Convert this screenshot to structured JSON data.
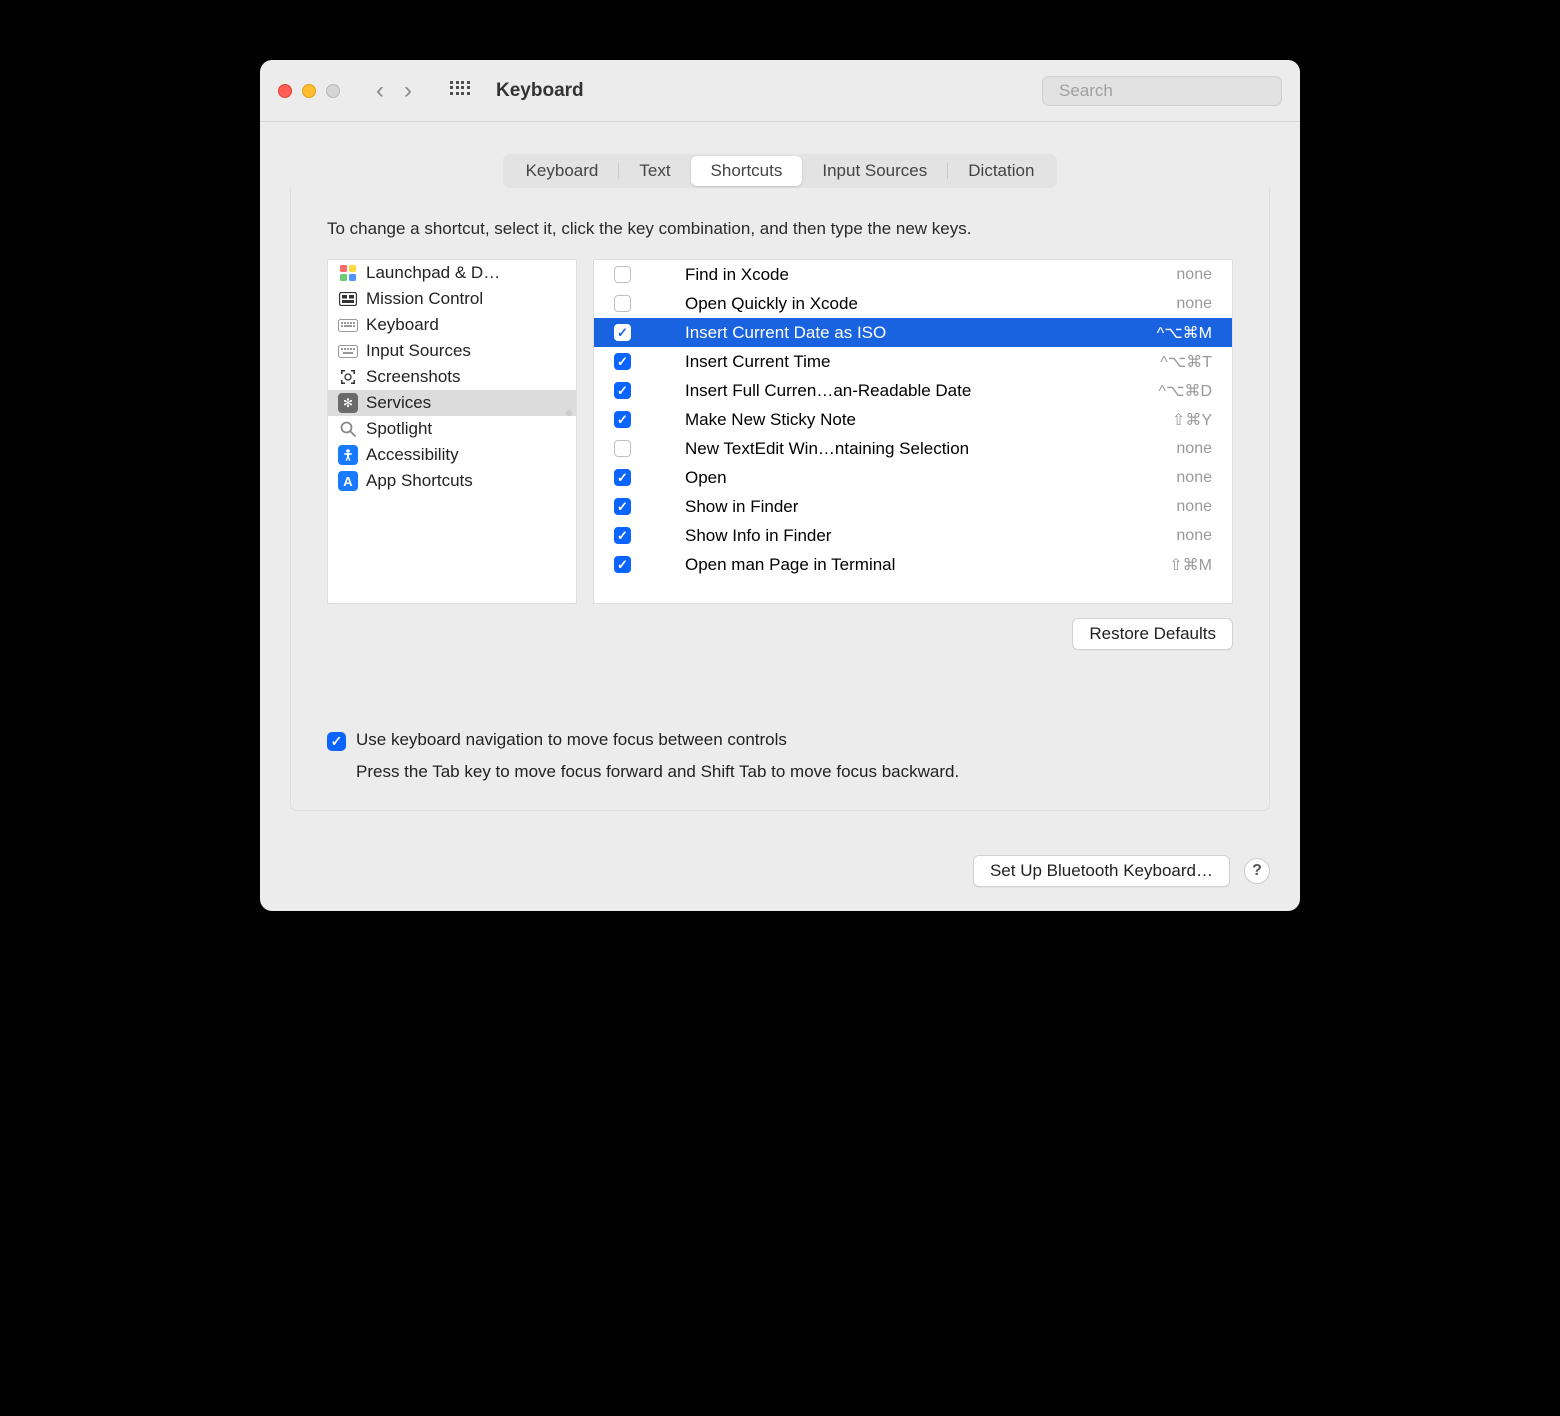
{
  "window": {
    "title": "Keyboard",
    "search_placeholder": "Search"
  },
  "tabs": [
    {
      "label": "Keyboard",
      "active": false
    },
    {
      "label": "Text",
      "active": false
    },
    {
      "label": "Shortcuts",
      "active": true
    },
    {
      "label": "Input Sources",
      "active": false
    },
    {
      "label": "Dictation",
      "active": false
    }
  ],
  "hint": "To change a shortcut, select it, click the key combination, and then type the new keys.",
  "categories": [
    {
      "label": "Launchpad & D…",
      "icon": "launchpad-icon",
      "selected": false
    },
    {
      "label": "Mission Control",
      "icon": "mission-control-icon",
      "selected": false
    },
    {
      "label": "Keyboard",
      "icon": "keyboard-icon",
      "selected": false
    },
    {
      "label": "Input Sources",
      "icon": "input-sources-icon",
      "selected": false
    },
    {
      "label": "Screenshots",
      "icon": "screenshots-icon",
      "selected": false
    },
    {
      "label": "Services",
      "icon": "services-icon",
      "selected": true
    },
    {
      "label": "Spotlight",
      "icon": "spotlight-icon",
      "selected": false
    },
    {
      "label": "Accessibility",
      "icon": "accessibility-icon",
      "selected": false
    },
    {
      "label": "App Shortcuts",
      "icon": "app-shortcuts-icon",
      "selected": false
    }
  ],
  "shortcuts": [
    {
      "checked": false,
      "label": "Find in Xcode",
      "key": "none",
      "selected": false
    },
    {
      "checked": false,
      "label": "Open Quickly in Xcode",
      "key": "none",
      "selected": false
    },
    {
      "checked": true,
      "label": "Insert Current Date as ISO",
      "key": "^⌥⌘M",
      "selected": true
    },
    {
      "checked": true,
      "label": "Insert Current Time",
      "key": "^⌥⌘T",
      "selected": false
    },
    {
      "checked": true,
      "label": "Insert Full Curren…an-Readable Date",
      "key": "^⌥⌘D",
      "selected": false
    },
    {
      "checked": true,
      "label": "Make New Sticky Note",
      "key": "⇧⌘Y",
      "selected": false
    },
    {
      "checked": false,
      "label": "New TextEdit Win…ntaining Selection",
      "key": "none",
      "selected": false
    },
    {
      "checked": true,
      "label": "Open",
      "key": "none",
      "selected": false
    },
    {
      "checked": true,
      "label": "Show in Finder",
      "key": "none",
      "selected": false
    },
    {
      "checked": true,
      "label": "Show Info in Finder",
      "key": "none",
      "selected": false
    },
    {
      "checked": true,
      "label": "Open man Page in Terminal",
      "key": "⇧⌘M",
      "selected": false
    }
  ],
  "restore_label": "Restore Defaults",
  "keyboard_nav": {
    "checked": true,
    "label": "Use keyboard navigation to move focus between controls",
    "hint": "Press the Tab key to move focus forward and Shift Tab to move focus backward."
  },
  "bluetooth_label": "Set Up Bluetooth Keyboard…",
  "help_label": "?"
}
